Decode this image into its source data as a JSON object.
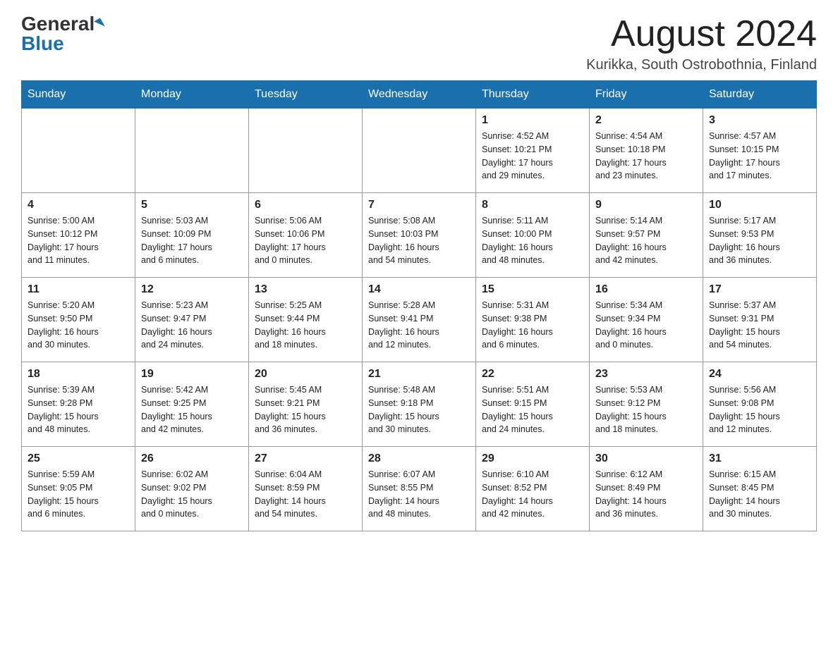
{
  "header": {
    "logo_general": "General",
    "logo_blue": "Blue",
    "month_title": "August 2024",
    "location": "Kurikka, South Ostrobothnia, Finland"
  },
  "weekdays": [
    "Sunday",
    "Monday",
    "Tuesday",
    "Wednesday",
    "Thursday",
    "Friday",
    "Saturday"
  ],
  "weeks": [
    [
      {
        "day": "",
        "info": ""
      },
      {
        "day": "",
        "info": ""
      },
      {
        "day": "",
        "info": ""
      },
      {
        "day": "",
        "info": ""
      },
      {
        "day": "1",
        "info": "Sunrise: 4:52 AM\nSunset: 10:21 PM\nDaylight: 17 hours\nand 29 minutes."
      },
      {
        "day": "2",
        "info": "Sunrise: 4:54 AM\nSunset: 10:18 PM\nDaylight: 17 hours\nand 23 minutes."
      },
      {
        "day": "3",
        "info": "Sunrise: 4:57 AM\nSunset: 10:15 PM\nDaylight: 17 hours\nand 17 minutes."
      }
    ],
    [
      {
        "day": "4",
        "info": "Sunrise: 5:00 AM\nSunset: 10:12 PM\nDaylight: 17 hours\nand 11 minutes."
      },
      {
        "day": "5",
        "info": "Sunrise: 5:03 AM\nSunset: 10:09 PM\nDaylight: 17 hours\nand 6 minutes."
      },
      {
        "day": "6",
        "info": "Sunrise: 5:06 AM\nSunset: 10:06 PM\nDaylight: 17 hours\nand 0 minutes."
      },
      {
        "day": "7",
        "info": "Sunrise: 5:08 AM\nSunset: 10:03 PM\nDaylight: 16 hours\nand 54 minutes."
      },
      {
        "day": "8",
        "info": "Sunrise: 5:11 AM\nSunset: 10:00 PM\nDaylight: 16 hours\nand 48 minutes."
      },
      {
        "day": "9",
        "info": "Sunrise: 5:14 AM\nSunset: 9:57 PM\nDaylight: 16 hours\nand 42 minutes."
      },
      {
        "day": "10",
        "info": "Sunrise: 5:17 AM\nSunset: 9:53 PM\nDaylight: 16 hours\nand 36 minutes."
      }
    ],
    [
      {
        "day": "11",
        "info": "Sunrise: 5:20 AM\nSunset: 9:50 PM\nDaylight: 16 hours\nand 30 minutes."
      },
      {
        "day": "12",
        "info": "Sunrise: 5:23 AM\nSunset: 9:47 PM\nDaylight: 16 hours\nand 24 minutes."
      },
      {
        "day": "13",
        "info": "Sunrise: 5:25 AM\nSunset: 9:44 PM\nDaylight: 16 hours\nand 18 minutes."
      },
      {
        "day": "14",
        "info": "Sunrise: 5:28 AM\nSunset: 9:41 PM\nDaylight: 16 hours\nand 12 minutes."
      },
      {
        "day": "15",
        "info": "Sunrise: 5:31 AM\nSunset: 9:38 PM\nDaylight: 16 hours\nand 6 minutes."
      },
      {
        "day": "16",
        "info": "Sunrise: 5:34 AM\nSunset: 9:34 PM\nDaylight: 16 hours\nand 0 minutes."
      },
      {
        "day": "17",
        "info": "Sunrise: 5:37 AM\nSunset: 9:31 PM\nDaylight: 15 hours\nand 54 minutes."
      }
    ],
    [
      {
        "day": "18",
        "info": "Sunrise: 5:39 AM\nSunset: 9:28 PM\nDaylight: 15 hours\nand 48 minutes."
      },
      {
        "day": "19",
        "info": "Sunrise: 5:42 AM\nSunset: 9:25 PM\nDaylight: 15 hours\nand 42 minutes."
      },
      {
        "day": "20",
        "info": "Sunrise: 5:45 AM\nSunset: 9:21 PM\nDaylight: 15 hours\nand 36 minutes."
      },
      {
        "day": "21",
        "info": "Sunrise: 5:48 AM\nSunset: 9:18 PM\nDaylight: 15 hours\nand 30 minutes."
      },
      {
        "day": "22",
        "info": "Sunrise: 5:51 AM\nSunset: 9:15 PM\nDaylight: 15 hours\nand 24 minutes."
      },
      {
        "day": "23",
        "info": "Sunrise: 5:53 AM\nSunset: 9:12 PM\nDaylight: 15 hours\nand 18 minutes."
      },
      {
        "day": "24",
        "info": "Sunrise: 5:56 AM\nSunset: 9:08 PM\nDaylight: 15 hours\nand 12 minutes."
      }
    ],
    [
      {
        "day": "25",
        "info": "Sunrise: 5:59 AM\nSunset: 9:05 PM\nDaylight: 15 hours\nand 6 minutes."
      },
      {
        "day": "26",
        "info": "Sunrise: 6:02 AM\nSunset: 9:02 PM\nDaylight: 15 hours\nand 0 minutes."
      },
      {
        "day": "27",
        "info": "Sunrise: 6:04 AM\nSunset: 8:59 PM\nDaylight: 14 hours\nand 54 minutes."
      },
      {
        "day": "28",
        "info": "Sunrise: 6:07 AM\nSunset: 8:55 PM\nDaylight: 14 hours\nand 48 minutes."
      },
      {
        "day": "29",
        "info": "Sunrise: 6:10 AM\nSunset: 8:52 PM\nDaylight: 14 hours\nand 42 minutes."
      },
      {
        "day": "30",
        "info": "Sunrise: 6:12 AM\nSunset: 8:49 PM\nDaylight: 14 hours\nand 36 minutes."
      },
      {
        "day": "31",
        "info": "Sunrise: 6:15 AM\nSunset: 8:45 PM\nDaylight: 14 hours\nand 30 minutes."
      }
    ]
  ]
}
